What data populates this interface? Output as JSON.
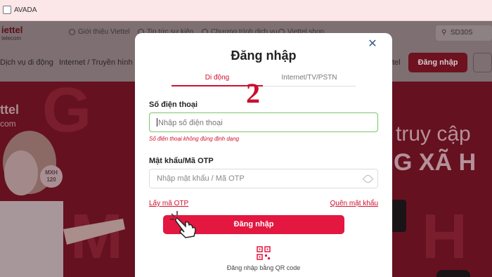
{
  "browser": {
    "bookmark_label": "AVADA"
  },
  "site_header": {
    "logo_name": "iettel",
    "logo_sub": "telecom",
    "top_links": [
      "Giới thiệu Viettel",
      "Tin tức sự kiện",
      "Chương trình dịch vụ",
      "Viettel shop"
    ],
    "search_text": "SD30S",
    "main_nav": [
      "Dịch vụ di động",
      "Internet / Truyền hình",
      "tel"
    ],
    "login_label": "Đăng nhập"
  },
  "banner": {
    "logo_name": "ttel",
    "logo_sub": "com",
    "mxh_badge": "MXH 120",
    "promo_line1": "truy cập",
    "promo_line2": "G XÃ H"
  },
  "modal": {
    "title": "Đăng nhập",
    "tabs": [
      {
        "label": "Di động",
        "active": true
      },
      {
        "label": "Internet/TV/PSTN",
        "active": false
      }
    ],
    "step_annotation": "2",
    "phone_label": "Số điện thoại",
    "phone_placeholder": "Nhập số điện thoại",
    "phone_error": "Số điện thoại không đúng định dạng",
    "password_label": "Mật khẩu/Mã OTP",
    "password_placeholder": "Nhập mật khẩu / Mã OTP",
    "get_otp_link": "Lấy mã OTP",
    "forgot_password_link": "Quên mật khẩu",
    "submit_label": "Đăng nhập",
    "qr_login_label": "Đăng nhập bằng QR code"
  },
  "colors": {
    "brand_red": "#e3173f",
    "error_red": "#d0102f",
    "valid_green": "#7cc56b"
  }
}
